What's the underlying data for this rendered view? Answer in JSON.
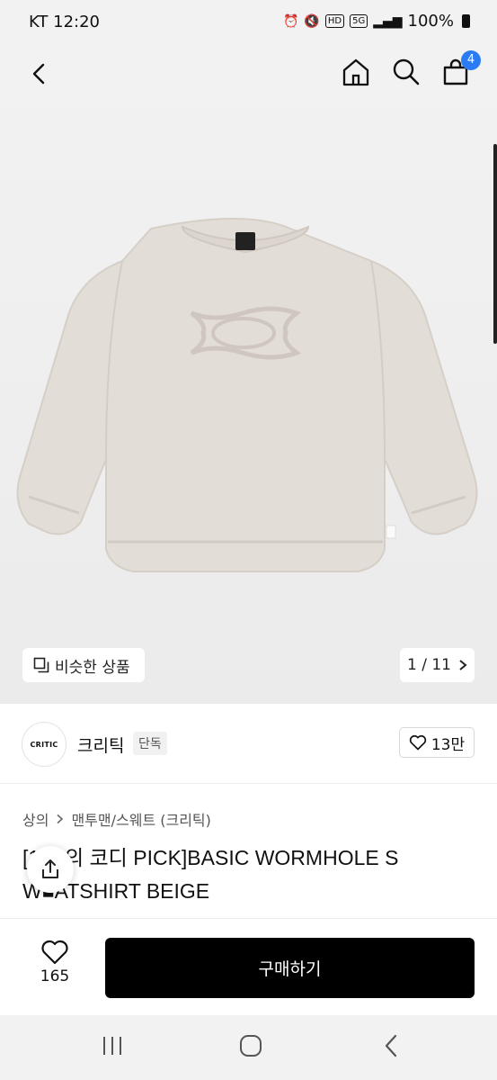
{
  "status_bar": {
    "carrier_time": "KT 12:20",
    "icons": [
      "alarm-icon",
      "mute-icon",
      "hd-icon",
      "5g-icon",
      "signal-icon"
    ],
    "hd": "HD",
    "network": "5G",
    "battery": "100%"
  },
  "header": {
    "icons": [
      "back-arrow-icon",
      "home-icon",
      "search-icon",
      "shopping-bag-icon"
    ],
    "cart_badge": "4"
  },
  "gallery": {
    "similar_label": "비슷한 상품",
    "page_indicator": "1 / 11",
    "product_color": "#e3ddd7"
  },
  "brand": {
    "logo_text": "CRITIC",
    "name": "크리틱",
    "tag": "단독",
    "like_count": "13만"
  },
  "breadcrumb": {
    "category": "상의",
    "subcategory": "맨투맨/스웨트 (크리틱)"
  },
  "product": {
    "title_line1": "[1■■의 코디 PICK]BASIC WORMHOLE S",
    "title_line2": "W■ATSHIRT BEIGE"
  },
  "bottom_bar": {
    "wish_count": "165",
    "buy_label": "구매하기"
  },
  "colors": {
    "accent": "#2a7bf4",
    "buy_button": "#000000",
    "background": "#f2f2f2"
  }
}
